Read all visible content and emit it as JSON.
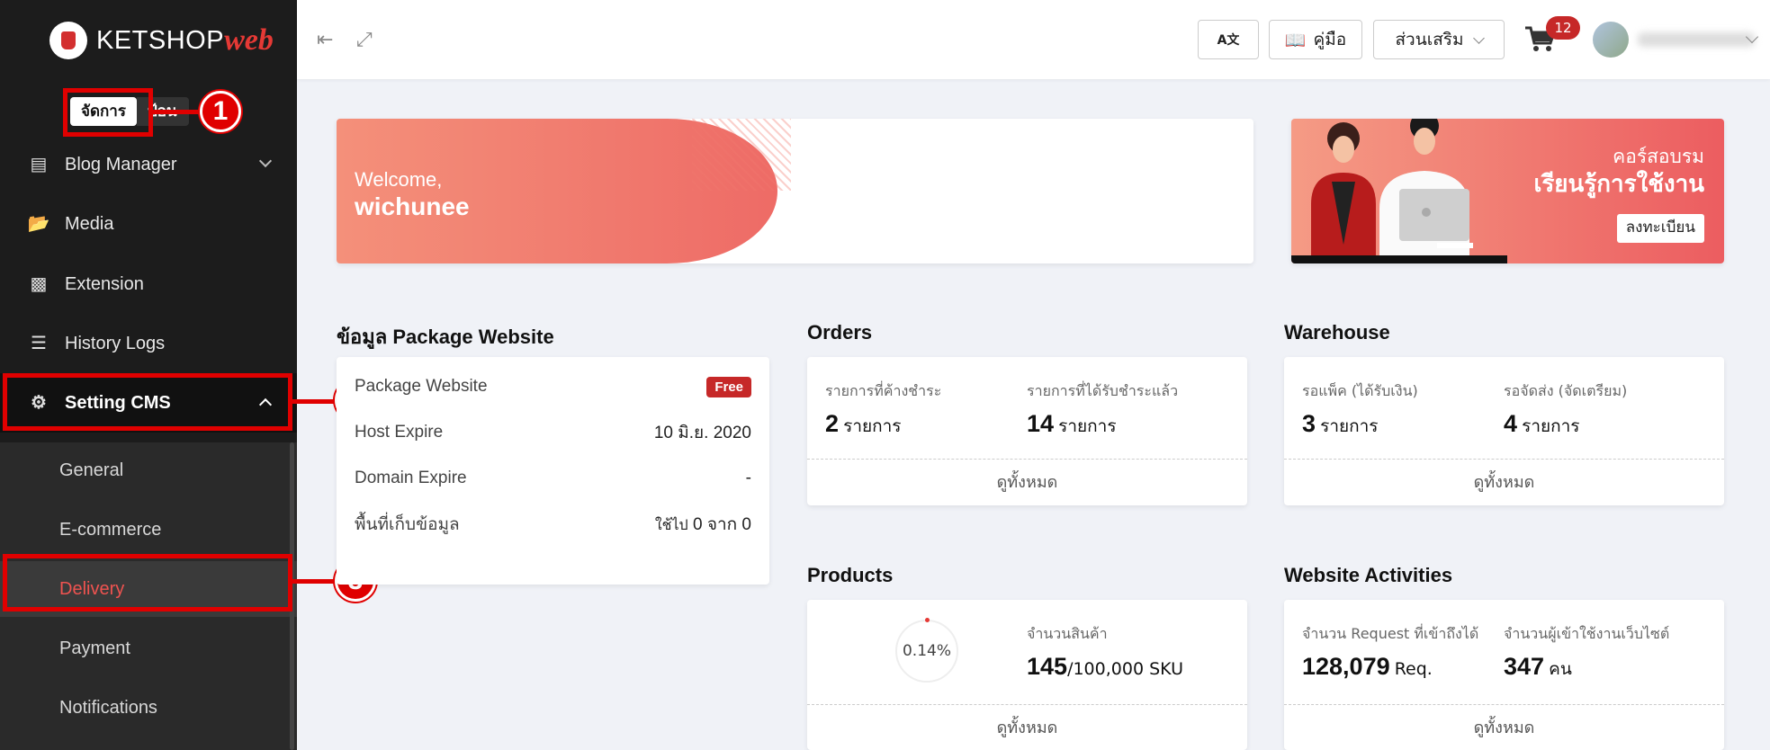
{
  "brand": {
    "logo_text": "KETSHOP",
    "logo_accent": "web"
  },
  "sidebar": {
    "mode_active": "จัดการ",
    "mode_inactive": "ป้อนขอ",
    "items": [
      {
        "label": "Blog Manager",
        "icon": "blog-icon"
      },
      {
        "label": "Media",
        "icon": "folder-icon"
      },
      {
        "label": "Extension",
        "icon": "puzzle-icon"
      },
      {
        "label": "History Logs",
        "icon": "list-icon"
      },
      {
        "label": "Setting CMS",
        "icon": "gear-icon"
      }
    ],
    "sub_items": [
      {
        "label": "General"
      },
      {
        "label": "E-commerce"
      },
      {
        "label": "Delivery"
      },
      {
        "label": "Payment"
      },
      {
        "label": "Notifications"
      }
    ]
  },
  "callouts": [
    "1",
    "2",
    "3"
  ],
  "topbar": {
    "translate_label": "A文",
    "manual_label": "คู่มือ",
    "addons_label": "ส่วนเสริม",
    "cart_count": "12"
  },
  "welcome": {
    "line1": "Welcome,",
    "line2": "wichunee"
  },
  "course": {
    "line1": "คอร์สอบรม",
    "line2": "เรียนรู้การใช้งาน",
    "button": "ลงทะเบียน"
  },
  "package": {
    "title": "ข้อมูล Package Website",
    "rows": [
      {
        "label": "Package Website",
        "value": "Free"
      },
      {
        "label": "Host Expire",
        "value": "10 มิ.ย. 2020"
      },
      {
        "label": "Domain Expire",
        "value": "-"
      },
      {
        "label": "พื้นที่เก็บข้อมูล",
        "value_prefix": "ใช้ไป",
        "value": "0",
        "value_mid": "จาก",
        "value2": "0"
      }
    ]
  },
  "orders": {
    "title": "Orders",
    "stats": [
      {
        "label": "รายการที่ค้างชำระ",
        "value": "2",
        "unit": "รายการ"
      },
      {
        "label": "รายการที่ได้รับชำระแล้ว",
        "value": "14",
        "unit": "รายการ"
      }
    ],
    "footer": "ดูทั้งหมด"
  },
  "warehouse": {
    "title": "Warehouse",
    "stats": [
      {
        "label": "รอแพ็ค (ได้รับเงิน)",
        "value": "3",
        "unit": "รายการ"
      },
      {
        "label": "รอจัดส่ง (จัดเตรียม)",
        "value": "4",
        "unit": "รายการ"
      }
    ],
    "footer": "ดูทั้งหมด"
  },
  "products": {
    "title": "Products",
    "percent": "0.14%",
    "label": "จำนวนสินค้า",
    "value": "145",
    "unit": "/100,000 SKU",
    "footer": "ดูทั้งหมด"
  },
  "activities": {
    "title": "Website Activities",
    "stats": [
      {
        "label": "จำนวน Request ที่เข้าถึงได้",
        "value": "128,079",
        "unit": "Req."
      },
      {
        "label": "จำนวนผู้เข้าใช้งานเว็บไซต์",
        "value": "347",
        "unit": "คน"
      }
    ],
    "footer": "ดูทั้งหมด"
  },
  "colors": {
    "accent": "#e53935",
    "callout": "#e00000",
    "sidebar_bg": "#1c1c1c"
  }
}
